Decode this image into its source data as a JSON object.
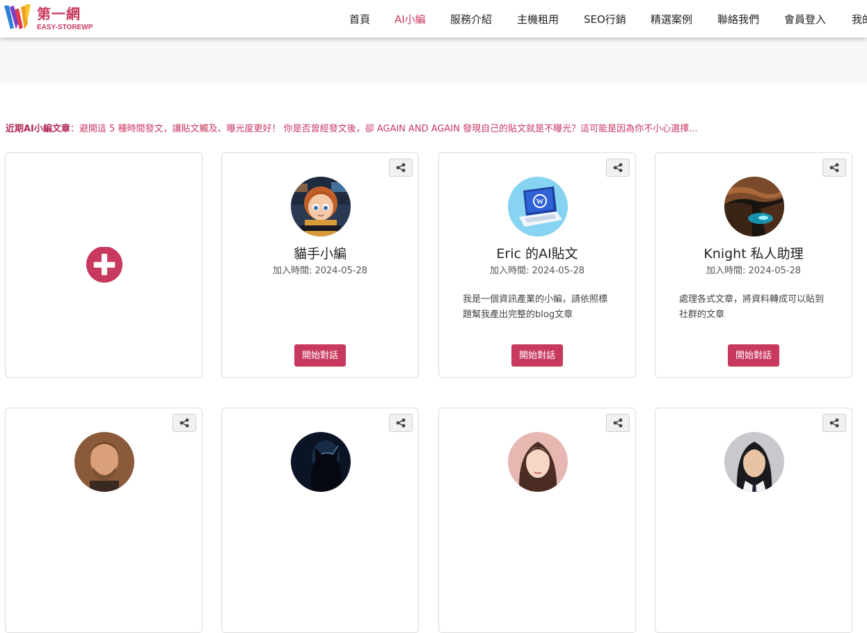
{
  "brand": {
    "name": "第一網",
    "subtitle": "EASY-STOREWP",
    "accent": "#c8395f"
  },
  "nav": {
    "items": [
      {
        "label": "首頁",
        "active": false
      },
      {
        "label": "AI小編",
        "active": true
      },
      {
        "label": "服務介紹",
        "active": false
      },
      {
        "label": "主機租用",
        "active": false
      },
      {
        "label": "SEO行銷",
        "active": false
      },
      {
        "label": "精選案例",
        "active": false
      },
      {
        "label": "聯絡我們",
        "active": false
      },
      {
        "label": "會員登入",
        "active": false
      },
      {
        "label": "我的",
        "active": false
      }
    ]
  },
  "recent": {
    "label": "近期AI小編文章",
    "text": "：避開這 5 種時間發文，讓貼文觸及、曝光度更好！ 你是否曾經發文後，卻 AGAIN AND AGAIN 發現自己的貼文就是不曝光？這可能是因為你不小心選擇..."
  },
  "cards": [
    {
      "name": "貓手小編",
      "date": "加入時間: 2024-05-28",
      "desc": "",
      "button": "開始對話",
      "avatar": "girl-coder-avatar"
    },
    {
      "name": "Eric 的AI貼文",
      "date": "加入時間: 2024-05-28",
      "desc": "我是一個資訊產業的小編，請依照標題幫我產出完整的blog文章",
      "button": "開始對話",
      "avatar": "wordpress-laptop-avatar"
    },
    {
      "name": "Knight 私人助理",
      "date": "加入時間: 2024-05-28",
      "desc": "處理各式文章，將資料轉成可以貼到社群的文章",
      "button": "開始對話",
      "avatar": "canyon-avatar"
    }
  ],
  "bottom_cards": [
    {
      "avatar": "man-portrait-avatar"
    },
    {
      "avatar": "cat-silhouette-avatar"
    },
    {
      "avatar": "woman-portrait-avatar"
    },
    {
      "avatar": "student-portrait-avatar"
    }
  ]
}
